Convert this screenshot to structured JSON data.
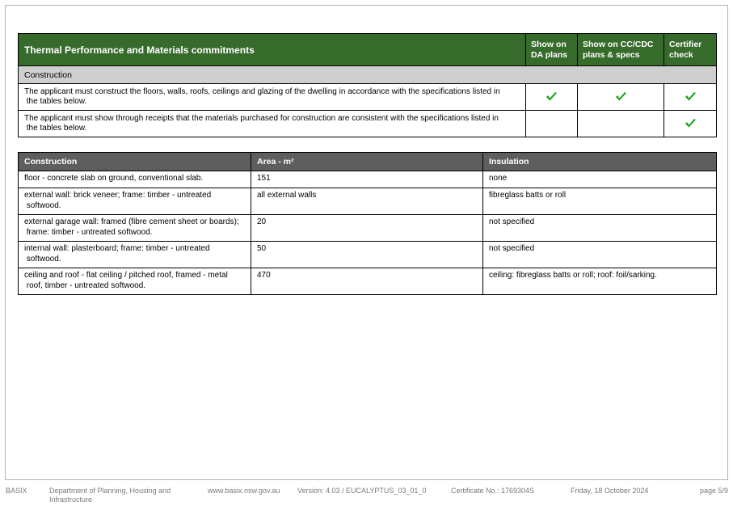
{
  "commitments": {
    "title": "Thermal Performance and Materials commitments",
    "col_da": [
      "Show on",
      "DA plans"
    ],
    "col_cc": [
      "Show on CC/CDC",
      "plans & specs"
    ],
    "col_cert": [
      "Certifier",
      "check"
    ],
    "section": "Construction",
    "rows": [
      {
        "text": [
          "The applicant must construct the floors, walls, roofs, ceilings and glazing of the dwelling in accordance with the specifications listed in",
          "the tables below."
        ],
        "da": true,
        "cc": true,
        "cert": true
      },
      {
        "text": [
          "The applicant must show through receipts that the materials purchased for construction are consistent with the specifications listed in",
          "the tables below."
        ],
        "da": false,
        "cc": false,
        "cert": true
      }
    ],
    "check_color": "#1aa31a",
    "header_color": "#376b2c"
  },
  "construction_table": {
    "headers": [
      "Construction",
      "Area - m²",
      "Insulation"
    ],
    "rows": [
      {
        "construction": [
          "floor - concrete slab on ground, conventional slab."
        ],
        "area": "151",
        "insulation": "none"
      },
      {
        "construction": [
          "external wall: brick veneer; frame: timber - untreated",
          "softwood."
        ],
        "area": "all external walls",
        "insulation": "fibreglass batts or roll"
      },
      {
        "construction": [
          "external garage wall: framed (fibre cement sheet or boards);",
          "frame: timber - untreated softwood."
        ],
        "area": "20",
        "insulation": "not specified"
      },
      {
        "construction": [
          "internal wall: plasterboard; frame: timber - untreated",
          "softwood."
        ],
        "area": "50",
        "insulation": "not specified"
      },
      {
        "construction": [
          "ceiling and roof - flat ceiling / pitched roof, framed - metal",
          "roof, timber - untreated softwood."
        ],
        "area": "470",
        "insulation": "ceiling: fibreglass batts or roll; roof: foil/sarking."
      }
    ],
    "header_color": "#5e5e5e"
  },
  "footer": {
    "basix": "BASIX",
    "department": [
      "Department of Planning, Housing and",
      "Infrastructure"
    ],
    "website": "www.basix.nsw.gov.au",
    "version": "Version: 4.03 / EUCALYPTUS_03_01_0",
    "certificate": "Certificate No.: 1769304S",
    "date": "Friday, 18 October 2024",
    "page": "page 5/9"
  }
}
